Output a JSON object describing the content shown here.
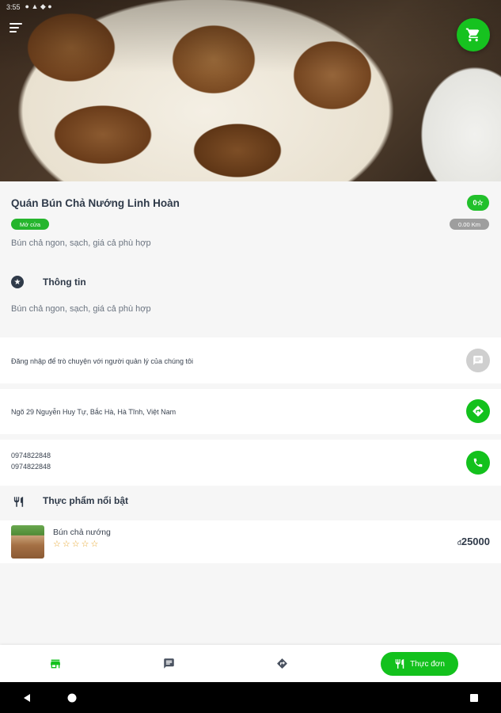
{
  "status_bar": {
    "time": "3:55"
  },
  "shop": {
    "name": "Quán Bún Chả Nướng Linh Hoàn",
    "rating": "0☆",
    "open_status": "Mở cửa",
    "distance": "0.00 Km",
    "description": "Bún chả ngon, sạch, giá cả phù hợp"
  },
  "info_section": {
    "title": "Thông tin",
    "description": "Bún chả ngon, sạch, giá cả phù hợp"
  },
  "chat_row": {
    "text": "Đăng nhập để trò chuyện với người quản lý của chúng tôi"
  },
  "address_row": {
    "text": "Ngõ 29 Nguyễn Huy Tự, Bắc Hà, Hà Tĩnh, Việt Nam"
  },
  "phone_row": {
    "phone1": "0974822848",
    "phone2": "0974822848"
  },
  "featured": {
    "title": "Thực phẩm nổi bật",
    "items": [
      {
        "name": "Bún chả nướng",
        "stars": "☆☆☆☆☆",
        "currency": "đ",
        "price": "25000"
      }
    ]
  },
  "bottom_nav": {
    "menu_label": "Thực đơn"
  },
  "colors": {
    "accent": "#13c11d",
    "text_dark": "#2f3a49",
    "muted": "#6b7480"
  }
}
